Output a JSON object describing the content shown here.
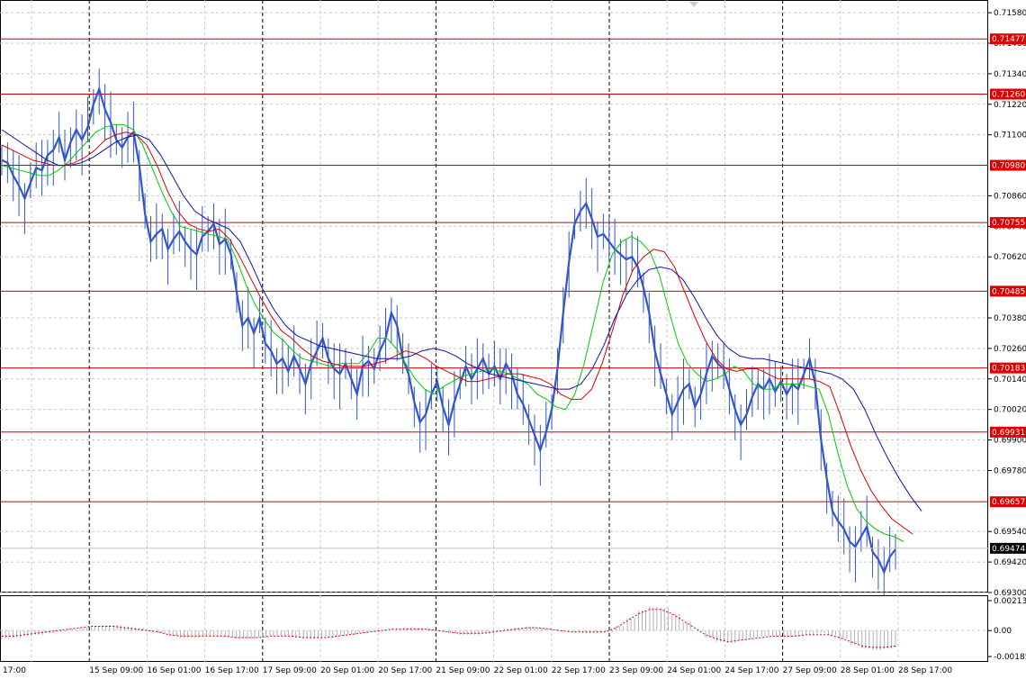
{
  "chart_data": {
    "type": "line",
    "price_axis": {
      "ylim": [
        0.693,
        0.7163
      ],
      "ticks": [
        "0.71580",
        "0.71460",
        "0.71340",
        "0.71220",
        "0.71100",
        "0.70860",
        "0.70740",
        "0.70620",
        "0.70380",
        "0.70260",
        "0.70140",
        "0.70020",
        "0.69900",
        "0.69780",
        "0.69540",
        "0.69420",
        "0.69300"
      ]
    },
    "time_axis": {
      "labels": [
        "17:00",
        "15 Sep 09:00",
        "16 Sep 01:00",
        "16 Sep 17:00",
        "17 Sep 09:00",
        "20 Sep 01:00",
        "20 Sep 17:00",
        "21 Sep 09:00",
        "22 Sep 01:00",
        "22 Sep 17:00",
        "23 Sep 09:00",
        "24 Sep 01:00",
        "24 Sep 17:00",
        "27 Sep 09:00",
        "28 Sep 01:00",
        "28 Sep 17:00"
      ]
    },
    "levels": [
      {
        "value": 0.71477,
        "label": "0.71477"
      },
      {
        "value": 0.7126,
        "label": "0.71260"
      },
      {
        "value": 0.7098,
        "label": "0.70980"
      },
      {
        "value": 0.70755,
        "label": "0.70755"
      },
      {
        "value": 0.70485,
        "label": "0.70485"
      },
      {
        "value": 0.70183,
        "label": "0.70183"
      },
      {
        "value": 0.69931,
        "label": "0.69931"
      },
      {
        "value": 0.69657,
        "label": "0.69657"
      }
    ],
    "current_price": {
      "value": 0.69474,
      "label": "0.69474"
    },
    "price_series": {
      "name": "",
      "color": "#3355cc",
      "values": [
        0.71,
        0.7099,
        0.7094,
        0.709,
        0.7085,
        0.7091,
        0.7097,
        0.7096,
        0.7102,
        0.7104,
        0.7109,
        0.71,
        0.7107,
        0.7112,
        0.7108,
        0.7113,
        0.7122,
        0.7128,
        0.712,
        0.7115,
        0.7108,
        0.7105,
        0.7109,
        0.7111,
        0.7098,
        0.7079,
        0.7068,
        0.7071,
        0.7073,
        0.7065,
        0.7069,
        0.7072,
        0.7068,
        0.7065,
        0.7063,
        0.707,
        0.7072,
        0.7075,
        0.7067,
        0.7069,
        0.7063,
        0.7048,
        0.7035,
        0.7038,
        0.7032,
        0.7038,
        0.7028,
        0.7025,
        0.702,
        0.7022,
        0.7017,
        0.7023,
        0.7018,
        0.7012,
        0.702,
        0.7025,
        0.703,
        0.7022,
        0.7018,
        0.7016,
        0.702,
        0.7014,
        0.7008,
        0.7019,
        0.7021,
        0.7018,
        0.7025,
        0.703,
        0.704,
        0.7035,
        0.7022,
        0.7016,
        0.7005,
        0.6997,
        0.7,
        0.7008,
        0.7013,
        0.7003,
        0.6996,
        0.7005,
        0.7012,
        0.7019,
        0.7014,
        0.7018,
        0.7022,
        0.7016,
        0.7019,
        0.7014,
        0.702,
        0.7016,
        0.7008,
        0.7004,
        0.6998,
        0.6992,
        0.6986,
        0.6993,
        0.7002,
        0.7018,
        0.704,
        0.706,
        0.7075,
        0.708,
        0.7083,
        0.7077,
        0.707,
        0.7071,
        0.7068,
        0.7065,
        0.7063,
        0.7061,
        0.7062,
        0.7058,
        0.705,
        0.704,
        0.7025,
        0.7016,
        0.7008,
        0.7,
        0.7005,
        0.701,
        0.7012,
        0.7003,
        0.7008,
        0.7016,
        0.7023,
        0.702,
        0.7018,
        0.701,
        0.7002,
        0.6996,
        0.7,
        0.7007,
        0.7012,
        0.701,
        0.7014,
        0.7009,
        0.7013,
        0.7008,
        0.7012,
        0.701,
        0.7016,
        0.7022,
        0.7012,
        0.699,
        0.6975,
        0.6962,
        0.6958,
        0.6955,
        0.695,
        0.6948,
        0.6952,
        0.6956,
        0.6946,
        0.6943,
        0.6938,
        0.6944,
        0.6947
      ]
    },
    "ma_series": [
      {
        "name": "",
        "color": "#00cc00",
        "values": [
          0.7098,
          0.7097,
          0.7096,
          0.7095,
          0.7094,
          0.7094,
          0.7096,
          0.7099,
          0.7103,
          0.7107,
          0.7111,
          0.7113,
          0.7114,
          0.7114,
          0.7112,
          0.7106,
          0.7097,
          0.7088,
          0.708,
          0.7074,
          0.7073,
          0.7072,
          0.7071,
          0.707,
          0.7069,
          0.7061,
          0.7051,
          0.7043,
          0.7037,
          0.7032,
          0.7029,
          0.7025,
          0.7022,
          0.7021,
          0.702,
          0.7019,
          0.702,
          0.702,
          0.702,
          0.7024,
          0.703,
          0.703,
          0.7026,
          0.702,
          0.7014,
          0.701,
          0.7008,
          0.7011,
          0.7013,
          0.7015,
          0.7016,
          0.7017,
          0.7018,
          0.7017,
          0.7016,
          0.7014,
          0.7012,
          0.7008,
          0.7006,
          0.7003,
          0.7002,
          0.7008,
          0.702,
          0.7036,
          0.7052,
          0.7063,
          0.7068,
          0.707,
          0.7068,
          0.7064,
          0.7055,
          0.7041,
          0.7028,
          0.702,
          0.7016,
          0.7013,
          0.7014,
          0.7016,
          0.7019,
          0.7017,
          0.7012,
          0.701,
          0.701,
          0.7012,
          0.7012,
          0.7012,
          0.7011,
          0.701,
          0.7,
          0.6985,
          0.6972,
          0.6963,
          0.6958,
          0.6955,
          0.6953,
          0.6952,
          0.695
        ]
      },
      {
        "name": "",
        "color": "#dd0000",
        "values": [
          0.7106,
          0.7104,
          0.7102,
          0.71,
          0.7099,
          0.7098,
          0.7098,
          0.7099,
          0.7101,
          0.7104,
          0.7108,
          0.711,
          0.7111,
          0.711,
          0.7106,
          0.7098,
          0.7088,
          0.708,
          0.7075,
          0.7073,
          0.7072,
          0.7073,
          0.7069,
          0.7062,
          0.7054,
          0.7046,
          0.7039,
          0.7033,
          0.703,
          0.7026,
          0.7023,
          0.7021,
          0.702,
          0.7019,
          0.7019,
          0.7019,
          0.702,
          0.7021,
          0.7023,
          0.7025,
          0.7024,
          0.7022,
          0.7019,
          0.7017,
          0.7015,
          0.7013,
          0.7013,
          0.7014,
          0.7015,
          0.7016,
          0.7016,
          0.7015,
          0.7014,
          0.7012,
          0.7008,
          0.7006,
          0.7006,
          0.701,
          0.702,
          0.7033,
          0.7047,
          0.7057,
          0.7062,
          0.7065,
          0.7064,
          0.7058,
          0.7048,
          0.7038,
          0.7029,
          0.7022,
          0.7018,
          0.7017,
          0.7018,
          0.7018,
          0.7016,
          0.7014,
          0.7014,
          0.7014,
          0.7014,
          0.7013,
          0.7011,
          0.7,
          0.6988,
          0.6978,
          0.697,
          0.6964,
          0.6959,
          0.6956,
          0.6953
        ]
      },
      {
        "name": "",
        "color": "#1010aa",
        "values": [
          0.7112,
          0.7109,
          0.7106,
          0.7103,
          0.71,
          0.7098,
          0.7098,
          0.7099,
          0.7101,
          0.7104,
          0.7107,
          0.7109,
          0.711,
          0.7108,
          0.7102,
          0.7094,
          0.7086,
          0.708,
          0.7077,
          0.7075,
          0.7073,
          0.7068,
          0.7059,
          0.7049,
          0.7041,
          0.7035,
          0.7031,
          0.7029,
          0.7027,
          0.7026,
          0.7025,
          0.7024,
          0.7023,
          0.7022,
          0.7022,
          0.7022,
          0.7023,
          0.7025,
          0.7026,
          0.7025,
          0.7023,
          0.702,
          0.7018,
          0.7016,
          0.7015,
          0.7014,
          0.7013,
          0.7012,
          0.7011,
          0.701,
          0.701,
          0.7012,
          0.7018,
          0.7027,
          0.7038,
          0.7047,
          0.7053,
          0.7057,
          0.7058,
          0.7057,
          0.7053,
          0.7046,
          0.7038,
          0.7031,
          0.7026,
          0.7023,
          0.7022,
          0.7022,
          0.7021,
          0.702,
          0.7019,
          0.7018,
          0.7017,
          0.7016,
          0.7014,
          0.701,
          0.7002,
          0.6992,
          0.6983,
          0.6975,
          0.6968,
          0.6962
        ]
      }
    ],
    "oscillator": {
      "ylim": [
        -0.00185,
        0.00213
      ],
      "ticks": [
        "0.00213",
        "0.00",
        "-0.00185"
      ],
      "histogram_color": "#b0b0b0",
      "signal_color": "#dd0000",
      "histogram": [
        -0.0006,
        -0.0005,
        -0.0004,
        -0.0003,
        -0.0002,
        -0.0001,
        0.0001,
        0.0002,
        0.0003,
        0.0004,
        0.0004,
        0.0003,
        0.0002,
        0.0,
        -0.0002,
        -0.0004,
        -0.0005,
        -0.0005,
        -0.0004,
        -0.0004,
        -0.0005,
        -0.0006,
        -0.0006,
        -0.0005,
        -0.0004,
        -0.0004,
        -0.0005,
        -0.0006,
        -0.0006,
        -0.0005,
        -0.0004,
        -0.0003,
        -0.0002,
        -0.0001,
        0.0,
        0.0001,
        0.0002,
        0.0002,
        0.0001,
        0.0,
        -0.0002,
        -0.0003,
        -0.0003,
        -0.0002,
        -0.0001,
        0.0001,
        0.0002,
        0.0003,
        0.0002,
        0.0001,
        0.0,
        -0.0001,
        -0.0002,
        -0.0002,
        -0.0001,
        0.0003,
        0.0009,
        0.0014,
        0.0017,
        0.0016,
        0.0012,
        0.0006,
        0.0,
        -0.0005,
        -0.0008,
        -0.0009,
        -0.0007,
        -0.0005,
        -0.0004,
        -0.0004,
        -0.0005,
        -0.0004,
        -0.0003,
        -0.0002,
        -0.0003,
        -0.0006,
        -0.001,
        -0.0013,
        -0.0014,
        -0.0013,
        -0.0012
      ],
      "signal": [
        -0.0004,
        -0.0004,
        -0.0003,
        -0.0002,
        -0.0001,
        0.0,
        0.0001,
        0.0002,
        0.0003,
        0.0003,
        0.0003,
        0.0002,
        0.0001,
        0.0,
        -0.0001,
        -0.0003,
        -0.0004,
        -0.0004,
        -0.0004,
        -0.0004,
        -0.0004,
        -0.0005,
        -0.0005,
        -0.0005,
        -0.0004,
        -0.0004,
        -0.0004,
        -0.0005,
        -0.0005,
        -0.0005,
        -0.0004,
        -0.0003,
        -0.0002,
        -0.0001,
        0.0,
        0.0001,
        0.0001,
        0.0001,
        0.0001,
        0.0,
        -0.0001,
        -0.0002,
        -0.0002,
        -0.0002,
        -0.0001,
        0.0,
        0.0001,
        0.0002,
        0.0002,
        0.0001,
        0.0,
        -0.0001,
        -0.0001,
        -0.0001,
        -0.0001,
        0.0002,
        0.0007,
        0.0012,
        0.0015,
        0.0015,
        0.0012,
        0.0007,
        0.0002,
        -0.0003,
        -0.0006,
        -0.0008,
        -0.0007,
        -0.0006,
        -0.0005,
        -0.0004,
        -0.0004,
        -0.0004,
        -0.0003,
        -0.0003,
        -0.0003,
        -0.0005,
        -0.0008,
        -0.0011,
        -0.0012,
        -0.0012,
        -0.0011
      ]
    }
  }
}
